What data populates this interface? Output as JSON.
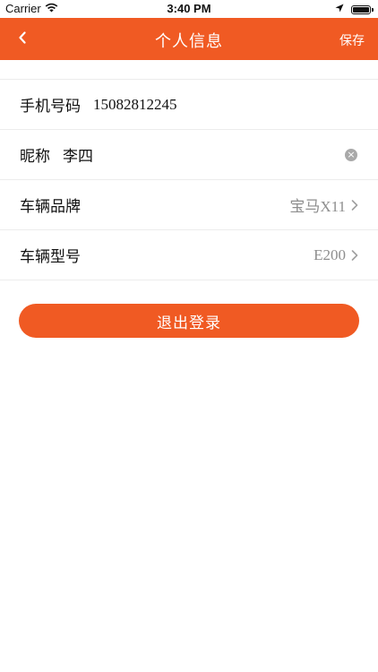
{
  "status_bar": {
    "carrier": "Carrier",
    "time": "3:40 PM",
    "icons": [
      "wifi-icon",
      "location-arrow-icon",
      "battery-icon"
    ]
  },
  "nav": {
    "title": "个人信息",
    "save_label": "保存",
    "back_icon": "chevron-left-icon",
    "background": "#f05a23"
  },
  "fields": {
    "phone": {
      "label": "手机号码",
      "value": "15082812245"
    },
    "nickname": {
      "label": "昵称",
      "value": "李四",
      "clear_icon": "clear-icon"
    },
    "brand": {
      "label": "车辆品牌",
      "value": "宝马X11",
      "chevron_icon": "chevron-right-icon"
    },
    "model": {
      "label": "车辆型号",
      "value": "E200",
      "chevron_icon": "chevron-right-icon"
    }
  },
  "logout": {
    "label": "退出登录",
    "background": "#f05a23"
  }
}
